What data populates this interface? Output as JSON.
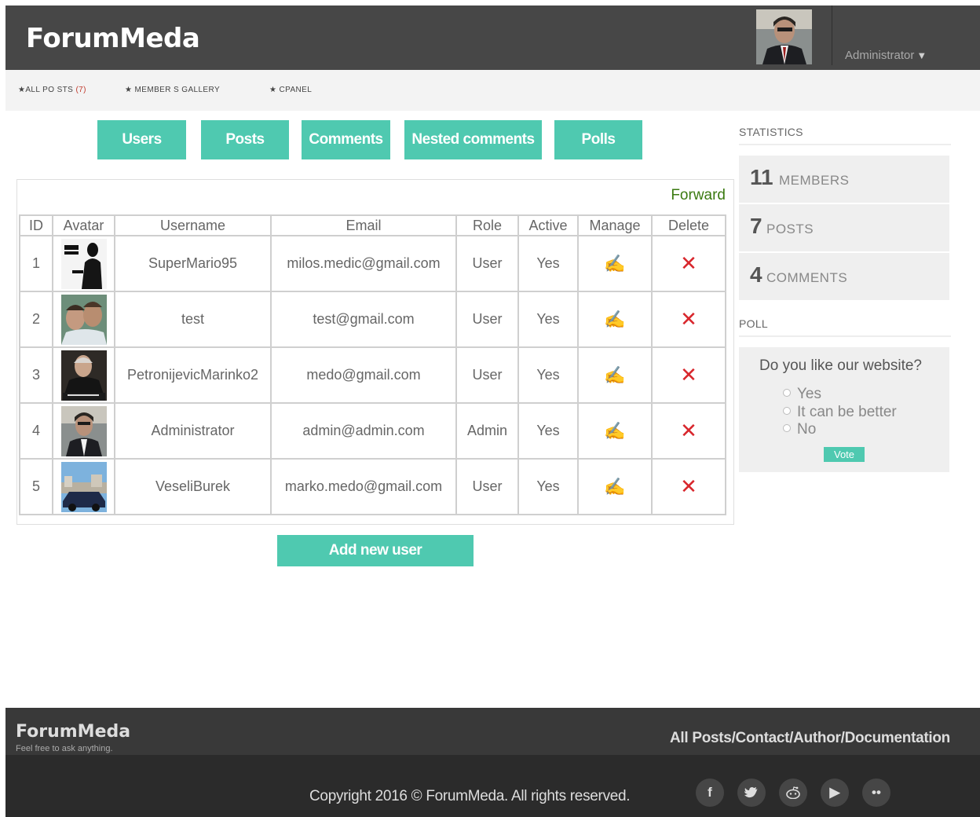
{
  "app": {
    "brand": "ForumMeda"
  },
  "header": {
    "user_label": "Administrator",
    "caret": "▼"
  },
  "topnav": {
    "items": [
      {
        "label": "★ALL PO STS",
        "count": "(7)"
      },
      {
        "label": "★ MEMBER S GALLERY"
      },
      {
        "label": "★ CPANEL"
      }
    ]
  },
  "tabs": [
    "Users",
    "Posts",
    "Comments",
    "Nested comments",
    "Polls"
  ],
  "table": {
    "forward_label": "Forward",
    "columns": [
      "ID",
      "Avatar",
      "Username",
      "Email",
      "Role",
      "Active",
      "Manage",
      "Delete"
    ],
    "rows": [
      {
        "id": "1",
        "username": "SuperMario95",
        "email": "milos.medic@gmail.com",
        "role": "User",
        "active": "Yes"
      },
      {
        "id": "2",
        "username": "test",
        "email": "test@gmail.com",
        "role": "User",
        "active": "Yes"
      },
      {
        "id": "3",
        "username": "PetronijevicMarinko2",
        "email": "medo@gmail.com",
        "role": "User",
        "active": "Yes"
      },
      {
        "id": "4",
        "username": "Administrator",
        "email": "admin@admin.com",
        "role": "Admin",
        "active": "Yes"
      },
      {
        "id": "5",
        "username": "VeseliBurek",
        "email": "marko.medo@gmail.com",
        "role": "User",
        "active": "Yes"
      }
    ],
    "manage_icon": "edit-hand-icon",
    "delete_icon": "✕"
  },
  "add_user_label": "Add new user",
  "sidebar": {
    "statistics_title": "STATISTICS",
    "stats": [
      {
        "value": "11",
        "label": "MEMBERS"
      },
      {
        "value": "7",
        "label": "POSTS"
      },
      {
        "value": "4",
        "label": "COMMENTS"
      }
    ],
    "poll_title": "POLL",
    "poll": {
      "question": "Do you like our website?",
      "options": [
        "Yes",
        "It can be better",
        "No"
      ],
      "vote_label": "Vote"
    }
  },
  "footer": {
    "brand": "ForumMeda",
    "tagline": "Feel free to ask anything.",
    "links": [
      "All Posts/",
      "Contact/",
      "Author/",
      "Documentation"
    ],
    "copyright": "Copyright 2016 © ForumMeda. All rights reserved.",
    "social": [
      {
        "icon": "facebook-icon",
        "glyph": "f"
      },
      {
        "icon": "twitter-icon",
        "glyph": "🐦"
      },
      {
        "icon": "reddit-icon",
        "glyph": "☺"
      },
      {
        "icon": "youtube-icon",
        "glyph": "▶"
      },
      {
        "icon": "flickr-icon",
        "glyph": "••"
      }
    ]
  }
}
